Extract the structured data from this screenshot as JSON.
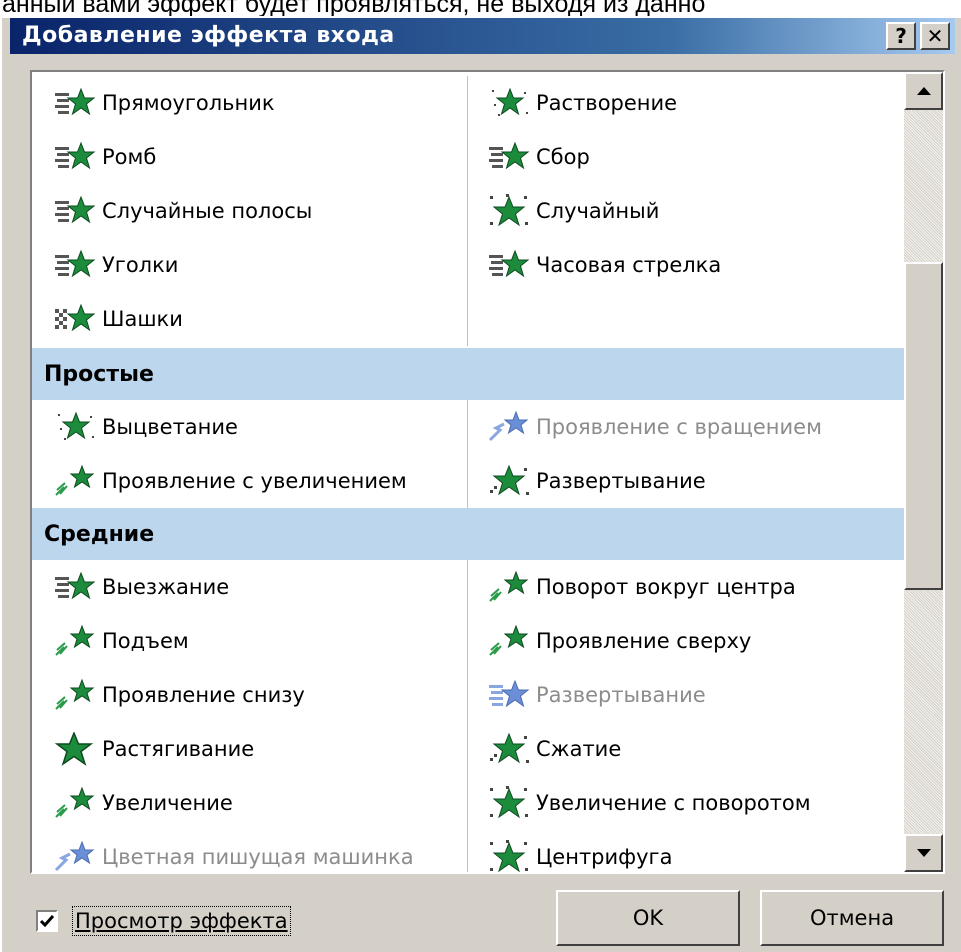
{
  "background_caption": "анный вами эффект будет проявляться, не выходя из данно",
  "dialog": {
    "title": "Добавление эффекта входа",
    "help_button": "?",
    "close_button": "✕"
  },
  "effects": {
    "top_rows": [
      {
        "left": "Прямоугольник",
        "right": "Растворение"
      },
      {
        "left": "Ромб",
        "right": "Сбор"
      },
      {
        "left": "Случайные полосы",
        "right": "Случайный"
      },
      {
        "left": "Уголки",
        "right": "Часовая стрелка"
      },
      {
        "left": "Шашки",
        "right": ""
      }
    ],
    "simple_header": "Простые",
    "simple_rows": [
      {
        "left": "Выцветание",
        "right": "Проявление с вращением"
      },
      {
        "left": "Проявление с увеличением",
        "right": "Развертывание"
      }
    ],
    "medium_header": "Средние",
    "medium_rows": [
      {
        "left": "Выезжание",
        "right": "Поворот вокруг центра"
      },
      {
        "left": "Подъем",
        "right": "Проявление сверху"
      },
      {
        "left": "Проявление снизу",
        "right": "Развертывание"
      },
      {
        "left": "Растягивание",
        "right": "Сжатие"
      },
      {
        "left": "Увеличение",
        "right": "Увеличение с поворотом"
      },
      {
        "left": "Цветная пишущая машинка",
        "right": "Центрифуга"
      }
    ]
  },
  "preview_checkbox": {
    "label": "Просмотр эффекта",
    "checked": true
  },
  "buttons": {
    "ok": "OK",
    "cancel": "Отмена"
  },
  "colors": {
    "title_start": "#0a246a",
    "category_bg": "#bcd6ee",
    "icon_green": "#1c8c3c",
    "icon_blue": "#6b8fd6"
  }
}
